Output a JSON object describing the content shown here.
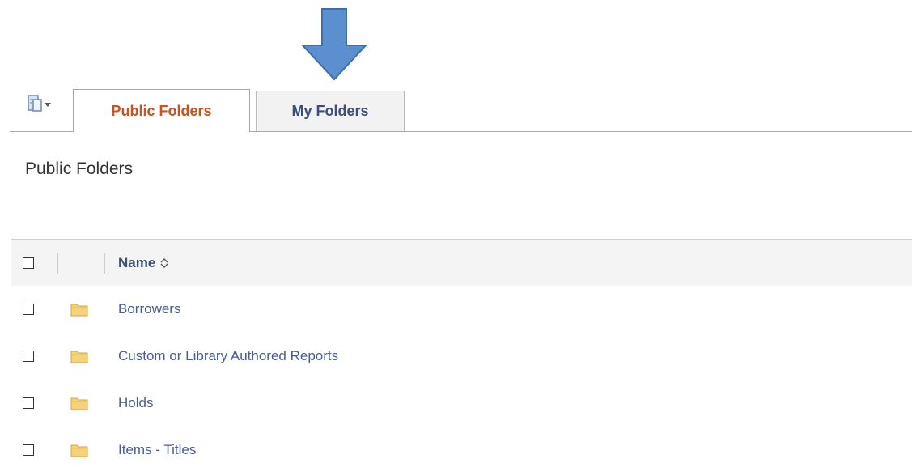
{
  "tabs": {
    "public": "Public Folders",
    "my": "My Folders"
  },
  "page_title": "Public Folders",
  "table": {
    "name_header": "Name",
    "rows": [
      {
        "name": "Borrowers"
      },
      {
        "name": "Custom or Library Authored Reports"
      },
      {
        "name": "Holds"
      },
      {
        "name": "Items - Titles"
      }
    ]
  },
  "icons": {
    "nav": "folder-navigation-icon",
    "folder": "folder-icon",
    "sort": "sort-icon",
    "annotation": "down-arrow-icon"
  },
  "colors": {
    "active_tab_text": "#c8531e",
    "link_text": "#4a5d8c",
    "arrow_fill": "#5b8fd0",
    "arrow_stroke": "#3f6ea8",
    "folder_fill": "#f6d37a"
  }
}
